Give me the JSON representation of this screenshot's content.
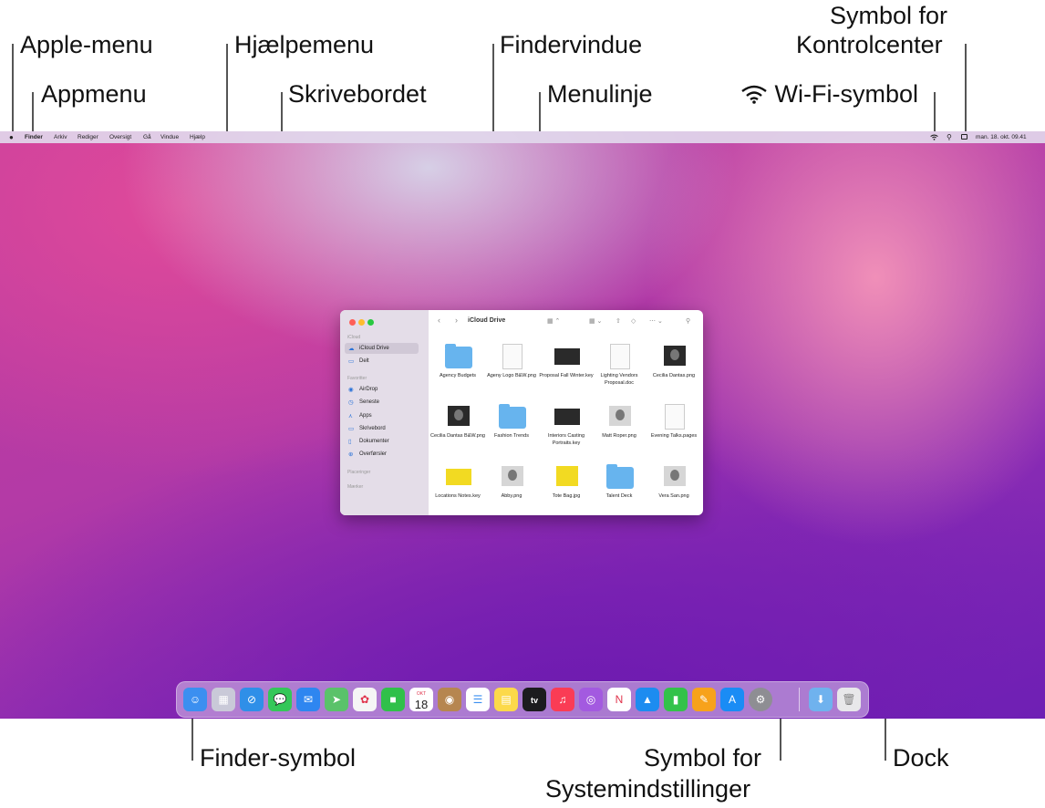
{
  "callouts": {
    "apple_menu": "Apple-menu",
    "app_menu": "Appmenu",
    "help_menu": "Hjælpemenu",
    "desktop": "Skrivebordet",
    "finder_window": "Findervindue",
    "menu_bar": "Menulinje",
    "wifi_symbol": "Wi-Fi-symbol",
    "control_center_line1": "Symbol for",
    "control_center_line2": "Kontrolcenter",
    "finder_symbol": "Finder-symbol",
    "system_settings_line1": "Symbol for",
    "system_settings_line2": "Systemindstillinger",
    "dock": "Dock"
  },
  "menubar": {
    "apple_icon": "apple-icon",
    "items": [
      "Finder",
      "Arkiv",
      "Rediger",
      "Oversigt",
      "Gå",
      "Vindue",
      "Hjælp"
    ],
    "datetime": "man. 18. okt.  09.41",
    "status_icons": [
      "wifi-icon",
      "spotlight-icon",
      "control-center-icon"
    ]
  },
  "finder": {
    "title": "iCloud Drive",
    "sidebar": {
      "sections": [
        {
          "label": "iCloud",
          "items": [
            {
              "label": "iCloud Drive",
              "icon": "☁",
              "selected": true
            },
            {
              "label": "Delt",
              "icon": "▭"
            }
          ]
        },
        {
          "label": "Favoritter",
          "items": [
            {
              "label": "AirDrop",
              "icon": "◉"
            },
            {
              "label": "Seneste",
              "icon": "◷"
            },
            {
              "label": "Apps",
              "icon": "⋏"
            },
            {
              "label": "Skrivebord",
              "icon": "▭"
            },
            {
              "label": "Dokumenter",
              "icon": "▯"
            },
            {
              "label": "Overførsler",
              "icon": "⊕"
            }
          ]
        },
        {
          "label": "Placeringer",
          "items": []
        },
        {
          "label": "Mærker",
          "items": []
        }
      ]
    },
    "files": [
      {
        "name": "Agency Budgets",
        "kind": "folder"
      },
      {
        "name": "Ageny Logo B&W.png",
        "kind": "logo"
      },
      {
        "name": "Proposal Fall Winter.key",
        "kind": "keynote"
      },
      {
        "name": "Lighting Vendors Proposal.doc",
        "kind": "doc"
      },
      {
        "name": "Cecilia Dantas.png",
        "kind": "photo"
      },
      {
        "name": "Cecilia Dantas B&W.png",
        "kind": "photo"
      },
      {
        "name": "Fashion Trends",
        "kind": "folder"
      },
      {
        "name": "Interiors Casting Portraits.key",
        "kind": "keynote"
      },
      {
        "name": "Matt Roper.png",
        "kind": "photo-bw"
      },
      {
        "name": "Evening Talks.pages",
        "kind": "doc"
      },
      {
        "name": "Locations Notes.key",
        "kind": "keynote-yellow"
      },
      {
        "name": "Abby.png",
        "kind": "photo-bw"
      },
      {
        "name": "Tote Bag.jpg",
        "kind": "tote"
      },
      {
        "name": "Talent Deck",
        "kind": "folder"
      },
      {
        "name": "Vera San.png",
        "kind": "photo-bw"
      }
    ]
  },
  "dock": {
    "calendar_month": "OKT",
    "calendar_day": "18",
    "tv_label": "tv",
    "apps": [
      {
        "name": "finder",
        "color": "#3b8ff0",
        "glyph": "☺"
      },
      {
        "name": "launchpad",
        "color": "#c9c9d8",
        "glyph": "▦"
      },
      {
        "name": "safari",
        "color": "#2f8fe8",
        "glyph": "⊘"
      },
      {
        "name": "messages",
        "color": "#34c759",
        "glyph": "💬"
      },
      {
        "name": "mail",
        "color": "#2e86f0",
        "glyph": "✉"
      },
      {
        "name": "maps",
        "color": "#5ac26a",
        "glyph": "➤"
      },
      {
        "name": "photos",
        "color": "#f5f5f5",
        "glyph": "✿"
      },
      {
        "name": "facetime",
        "color": "#30c04a",
        "glyph": "■"
      },
      {
        "name": "calendar",
        "color": "#ffffff",
        "glyph": ""
      },
      {
        "name": "contacts",
        "color": "#b68650",
        "glyph": "◉"
      },
      {
        "name": "reminders",
        "color": "#ffffff",
        "glyph": "☰"
      },
      {
        "name": "notes",
        "color": "#fcd94a",
        "glyph": "▤"
      },
      {
        "name": "tv",
        "color": "#1c1c1e",
        "glyph": ""
      },
      {
        "name": "music",
        "color": "#fa3c55",
        "glyph": "♫"
      },
      {
        "name": "podcasts",
        "color": "#a35ae0",
        "glyph": "◎"
      },
      {
        "name": "news",
        "color": "#ffffff",
        "glyph": "N"
      },
      {
        "name": "keynote",
        "color": "#1d8cf0",
        "glyph": "▲"
      },
      {
        "name": "numbers",
        "color": "#33c24a",
        "glyph": "▮"
      },
      {
        "name": "pages",
        "color": "#f7a21b",
        "glyph": "✎"
      },
      {
        "name": "app-store",
        "color": "#1a8cf5",
        "glyph": "A"
      },
      {
        "name": "system-settings",
        "color": "#8e8e93",
        "glyph": "⚙"
      },
      {
        "name": "downloads-folder",
        "color": "#6fb2ee",
        "glyph": "⬇"
      },
      {
        "name": "trash",
        "color": "#e8e8ea",
        "glyph": "🗑"
      }
    ]
  }
}
